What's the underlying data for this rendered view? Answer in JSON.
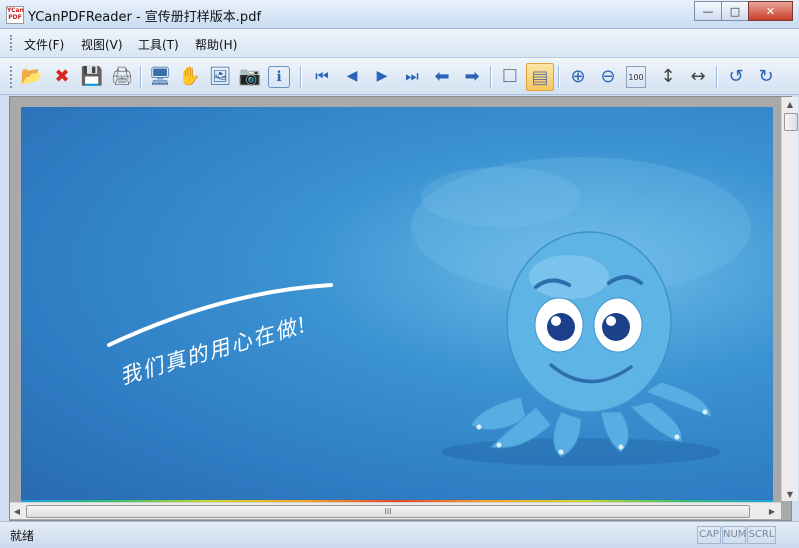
{
  "window": {
    "app_icon_text": "YCan PDF",
    "title": "YCanPDFReader - 宣传册打样版本.pdf",
    "controls": {
      "minimize": "—",
      "maximize": "□",
      "close": "✕"
    }
  },
  "menu": {
    "items": [
      {
        "label": "文件(F)"
      },
      {
        "label": "视图(V)"
      },
      {
        "label": "工具(T)"
      },
      {
        "label": "帮助(H)"
      }
    ]
  },
  "toolbar": {
    "buttons": [
      {
        "icon": "open-folder-icon",
        "glyph": "📂"
      },
      {
        "icon": "close-document-icon",
        "glyph": "✖"
      },
      {
        "icon": "save-icon",
        "glyph": "💾"
      },
      {
        "icon": "print-icon",
        "glyph": "🖨"
      },
      {
        "icon": "fullscreen-icon",
        "glyph": "🖥"
      },
      {
        "icon": "hand-tool-icon",
        "glyph": "✋"
      },
      {
        "icon": "select-image-icon",
        "glyph": "🖼"
      },
      {
        "icon": "snapshot-icon",
        "glyph": "📷"
      },
      {
        "icon": "info-icon",
        "glyph": "ℹ"
      },
      {
        "icon": "first-page-icon",
        "glyph": "⏮"
      },
      {
        "icon": "previous-page-icon",
        "glyph": "◀"
      },
      {
        "icon": "next-page-icon",
        "glyph": "▶"
      },
      {
        "icon": "last-page-icon",
        "glyph": "⏭"
      },
      {
        "icon": "back-icon",
        "glyph": "⬅"
      },
      {
        "icon": "forward-icon",
        "glyph": "➡"
      },
      {
        "icon": "single-page-icon",
        "glyph": "☐"
      },
      {
        "icon": "continuous-page-icon",
        "glyph": "▤",
        "active": true
      },
      {
        "icon": "zoom-in-icon",
        "glyph": "⊕"
      },
      {
        "icon": "zoom-out-icon",
        "glyph": "⊖"
      },
      {
        "icon": "actual-size-icon",
        "glyph": "100"
      },
      {
        "icon": "fit-height-icon",
        "glyph": "↕"
      },
      {
        "icon": "fit-width-icon",
        "glyph": "↔"
      },
      {
        "icon": "rotate-left-icon",
        "glyph": "↺"
      },
      {
        "icon": "rotate-right-icon",
        "glyph": "↻"
      }
    ]
  },
  "document": {
    "slogan": "我们真的用心在做!"
  },
  "scrollbar": {
    "grip": "III",
    "up": "▲",
    "down": "▼",
    "left": "◀",
    "right": "▶"
  },
  "status": {
    "text": "就绪",
    "indicators": [
      "CAP",
      "NUM",
      "SCRL"
    ]
  },
  "colors": {
    "page_background": "#3b8fd0",
    "octopus": "#5fb4e6",
    "accent_active": "#f6c563"
  }
}
